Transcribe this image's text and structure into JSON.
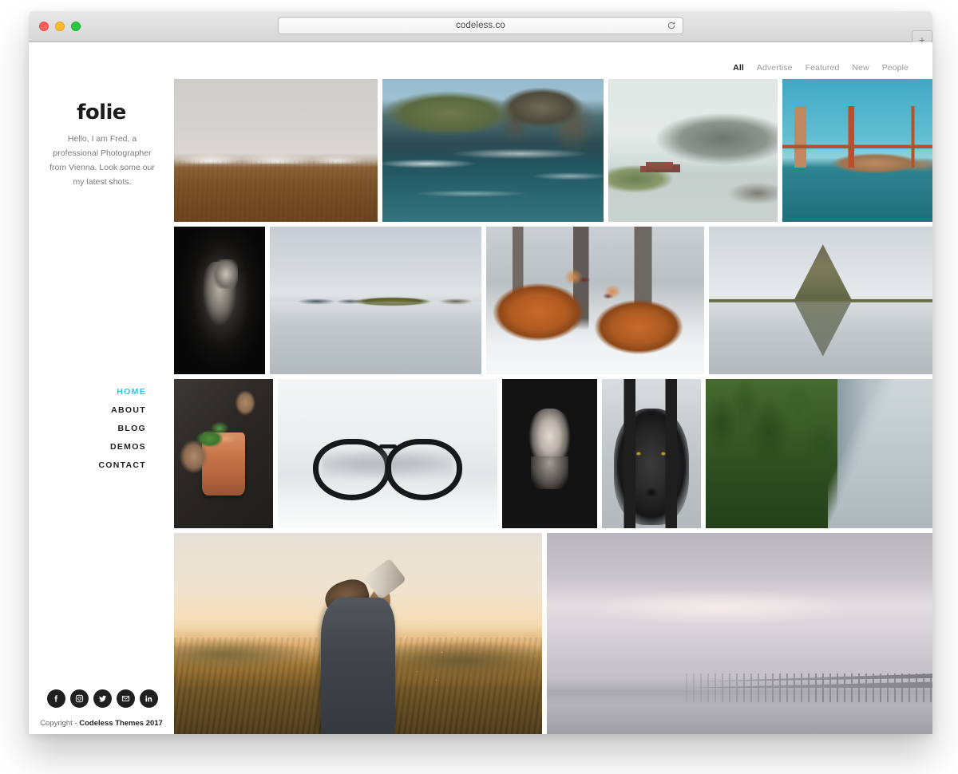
{
  "browser": {
    "url": "codeless.co",
    "reload_label": "Reload",
    "new_tab_label": "+",
    "traffic_lights": [
      "close",
      "minimize",
      "zoom"
    ]
  },
  "sidebar": {
    "logo": "folie",
    "tagline": "Hello, I am Fred, a professional Photographer from Vienna. Look some our my latest shots.",
    "nav": [
      {
        "label": "HOME",
        "active": true
      },
      {
        "label": "ABOUT",
        "active": false
      },
      {
        "label": "BLOG",
        "active": false
      },
      {
        "label": "DEMOS",
        "active": false
      },
      {
        "label": "CONTACT",
        "active": false
      }
    ],
    "social": [
      {
        "name": "facebook-icon"
      },
      {
        "name": "instagram-icon"
      },
      {
        "name": "twitter-icon"
      },
      {
        "name": "email-icon"
      },
      {
        "name": "linkedin-icon"
      }
    ],
    "copyright_prefix": "Copyright - ",
    "copyright_brand": "Codeless Themes 2017"
  },
  "filters": [
    {
      "label": "All",
      "active": true
    },
    {
      "label": "Advertise",
      "active": false
    },
    {
      "label": "Featured",
      "active": false
    },
    {
      "label": "New",
      "active": false
    },
    {
      "label": "People",
      "active": false
    }
  ],
  "gallery": {
    "items": [
      {
        "id": 1,
        "alt": "Snow-capped mountains over brown tundra plain"
      },
      {
        "id": 2,
        "alt": "Rocky coastal cliffs with crashing turquoise waves"
      },
      {
        "id": 3,
        "alt": "Misty fjord with small red cabin on the shore"
      },
      {
        "id": 4,
        "alt": "Golden Gate Bridge over teal bay water"
      },
      {
        "id": 5,
        "alt": "Black and white portrait of photographer holding camera"
      },
      {
        "id": 6,
        "alt": "Mirror-still lake reflecting green hills"
      },
      {
        "id": 7,
        "alt": "Two red foxes playing in the snow"
      },
      {
        "id": 8,
        "alt": "Kirkjufell mountain mirrored in calm water"
      },
      {
        "id": 9,
        "alt": "Hands garnishing a copper mug cocktail with mint"
      },
      {
        "id": 10,
        "alt": "Black round eyeglasses on a white surface"
      },
      {
        "id": 11,
        "alt": "Black and white portrait of a woman on dark background"
      },
      {
        "id": 12,
        "alt": "Black wolf with yellow eyes in snow"
      },
      {
        "id": 13,
        "alt": "Forested coastline cliff with ships on the sea"
      },
      {
        "id": 14,
        "alt": "Bearded man drinking water at golden hour sunset"
      },
      {
        "id": 15,
        "alt": "Long arched bridge vanishing into misty sea"
      }
    ]
  },
  "colors": {
    "accent": "#2ec6e8",
    "text_dark": "#1c1c1c",
    "text_muted": "#7b7b7b",
    "page_bg": "#ffffff"
  }
}
